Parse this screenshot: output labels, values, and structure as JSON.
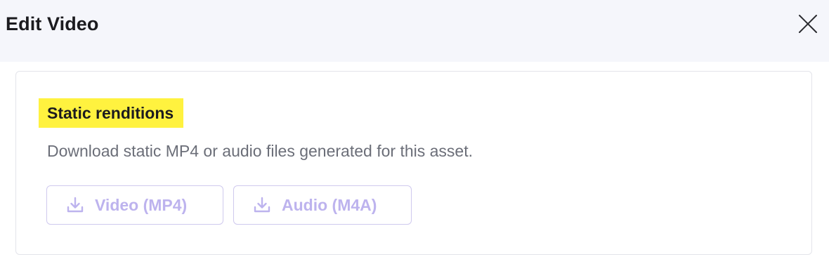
{
  "dialog": {
    "title": "Edit Video",
    "close_icon": "close-icon"
  },
  "static_renditions": {
    "title": "Static renditions",
    "description": "Download static MP4 or audio files generated for this asset.",
    "highlight_color": "#fff23f",
    "buttons": [
      {
        "label": "Video (MP4)",
        "icon": "download-icon",
        "state": "disabled"
      },
      {
        "label": "Audio (M4A)",
        "icon": "download-icon",
        "state": "disabled"
      }
    ],
    "button_color": "#bdb3ee"
  }
}
